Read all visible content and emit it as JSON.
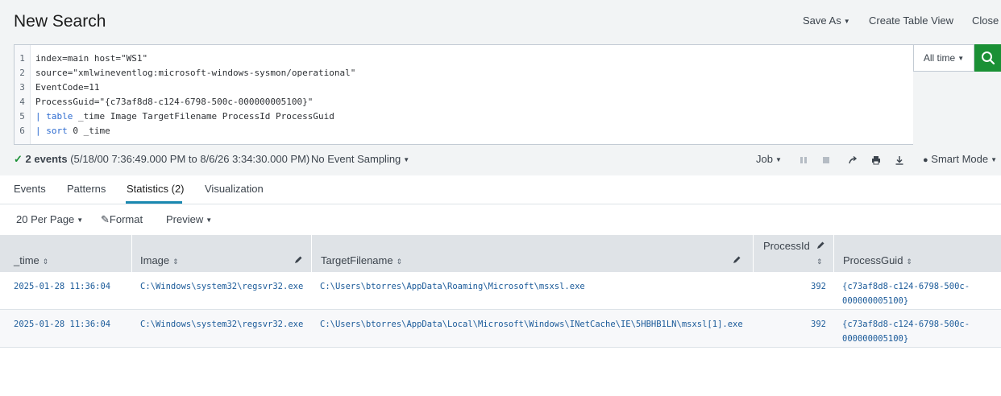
{
  "header": {
    "title": "New Search",
    "save_as": "Save As",
    "create_table_view": "Create Table View",
    "close": "Close"
  },
  "query": {
    "line_numbers": [
      "1",
      "2",
      "3",
      "4",
      "5",
      "6"
    ],
    "line1": "index=main host=\"WS1\"",
    "line2": "source=\"xmlwineventlog:microsoft-windows-sysmon/operational\"",
    "line3": "EventCode=11",
    "line4": "ProcessGuid=\"{c73af8d8-c124-6798-500c-000000005100}\"",
    "line5_pipe": "| ",
    "line5_cmd": "table",
    "line5_rest": " _time Image TargetFilename ProcessId ProcessGuid",
    "line6_pipe": "| ",
    "line6_cmd": "sort",
    "line6_rest": " 0 _time"
  },
  "time_picker": {
    "label": "All time"
  },
  "status": {
    "events": "2 events",
    "range": "(5/18/00 7:36:49.000 PM to 8/6/26 3:34:30.000 PM)",
    "sampling": "No Event Sampling",
    "job": "Job",
    "mode": "Smart Mode"
  },
  "tabs": [
    "Events",
    "Patterns",
    "Statistics (2)",
    "Visualization"
  ],
  "toolbar": {
    "per_page": "20 Per Page",
    "format": "Format",
    "preview": "Preview"
  },
  "table": {
    "columns": [
      "_time",
      "Image",
      "TargetFilename",
      "ProcessId",
      "ProcessGuid"
    ],
    "rows": [
      {
        "time": "2025-01-28 11:36:04",
        "image": "C:\\Windows\\system32\\regsvr32.exe",
        "target": "C:\\Users\\btorres\\AppData\\Roaming\\Microsoft\\msxsl.exe",
        "pid": "392",
        "guid_1": "{c73af8d8-c124-6798-500c-",
        "guid_2": "000000005100}"
      },
      {
        "time": "2025-01-28 11:36:04",
        "image": "C:\\Windows\\system32\\regsvr32.exe",
        "target": "C:\\Users\\btorres\\AppData\\Local\\Microsoft\\Windows\\INetCache\\IE\\5HBHB1LN\\msxsl[1].exe",
        "pid": "392",
        "guid_1": "{c73af8d8-c124-6798-500c-",
        "guid_2": "000000005100}"
      }
    ]
  },
  "colors": {
    "accent_green": "#1a9035",
    "tab_underline": "#1a88b0",
    "link_blue": "#1a5a99",
    "keyword_blue": "#2d6bd0"
  }
}
